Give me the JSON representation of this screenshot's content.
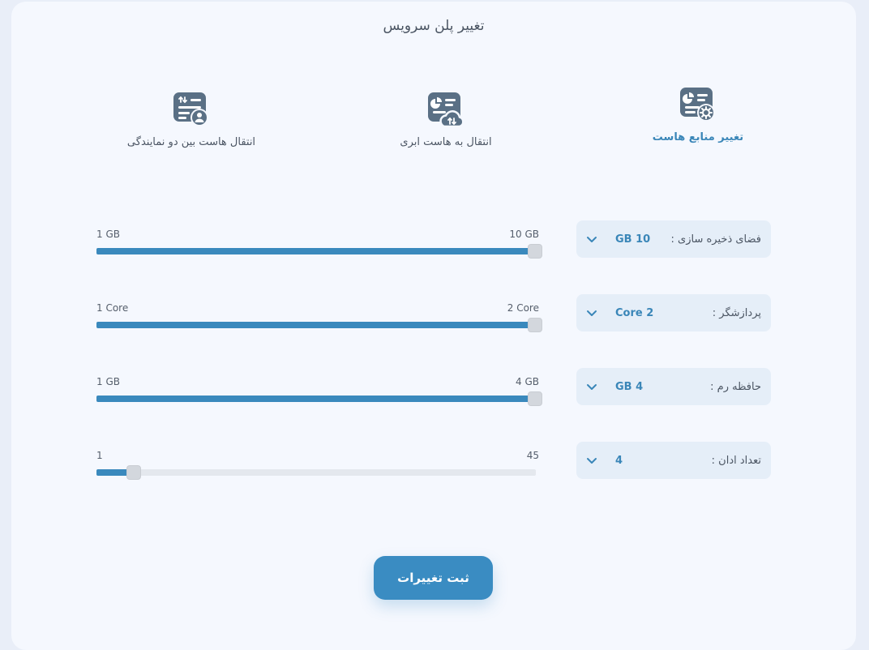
{
  "page": {
    "title": "تغییر پلن سرویس"
  },
  "tabs": [
    {
      "label": "تغییر منابع هاست",
      "icon": "server-settings-icon",
      "active": true
    },
    {
      "label": "انتقال به هاست ابری",
      "icon": "cloud-transfer-icon",
      "active": false
    },
    {
      "label": "انتقال هاست بین دو نمایندگی",
      "icon": "agency-transfer-icon",
      "active": false
    }
  ],
  "resources": [
    {
      "label": "فضای ذخیره سازی :",
      "value": "10 GB",
      "min_label": "1 GB",
      "max_label": "10 GB",
      "min": 1,
      "max": 10,
      "current": 10
    },
    {
      "label": "پردازشگر :",
      "value": "2 Core",
      "min_label": "1 Core",
      "max_label": "2 Core",
      "min": 1,
      "max": 2,
      "current": 2
    },
    {
      "label": "حافظه رم :",
      "value": "4 GB",
      "min_label": "1 GB",
      "max_label": "4 GB",
      "min": 1,
      "max": 4,
      "current": 4
    },
    {
      "label": "تعداد ادان :",
      "value": "4",
      "min_label": "1",
      "max_label": "45",
      "min": 1,
      "max": 45,
      "current": 4
    }
  ],
  "actions": {
    "submit_label": "ثبت تغییرات"
  },
  "colors": {
    "accent": "#3a8cc2",
    "icon": "#5a7085",
    "panel": "#f5f8fe"
  }
}
